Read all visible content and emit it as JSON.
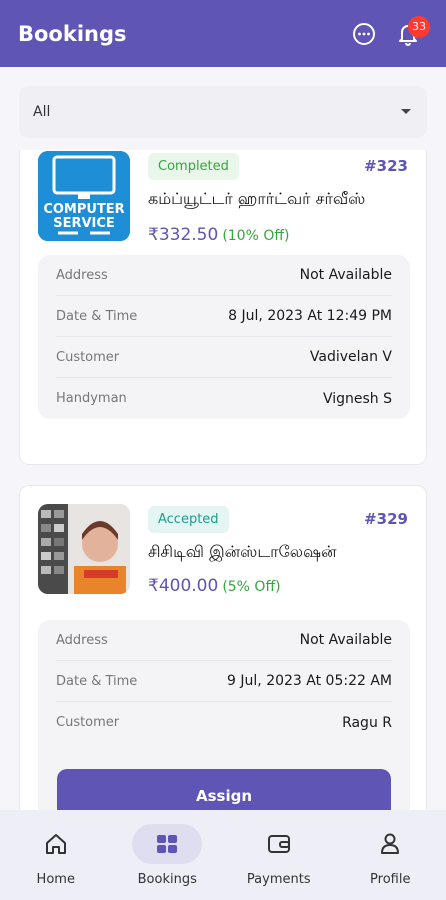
{
  "header": {
    "title": "Bookings",
    "notification_count": "33"
  },
  "filter": {
    "value": "All"
  },
  "bookings": [
    {
      "status": "Completed",
      "id": "#323",
      "service": "கம்ப்யூட்டர் ஹார்ட்வர் சர்வீஸ்",
      "price": "₹332.50",
      "discount": "(10% Off)",
      "thumb_text": [
        "COMPUTER",
        "SERVICE"
      ],
      "details": [
        {
          "label": "Address",
          "value": "Not Available"
        },
        {
          "label": "Date & Time",
          "value": "8 Jul, 2023 At 12:49 PM"
        },
        {
          "label": "Customer",
          "value": "Vadivelan V"
        },
        {
          "label": "Handyman",
          "value": "Vignesh S"
        }
      ]
    },
    {
      "status": "Accepted",
      "id": "#329",
      "service": "சிசிடிவி இன்ஸ்டாலேஷன்",
      "price": "₹400.00",
      "discount": "(5% Off)",
      "details": [
        {
          "label": "Address",
          "value": "Not Available"
        },
        {
          "label": "Date & Time",
          "value": "9 Jul, 2023 At 05:22 AM"
        },
        {
          "label": "Customer",
          "value": "Ragu R"
        }
      ],
      "action_label": "Assign"
    }
  ],
  "nav": [
    {
      "label": "Home",
      "icon": "home-icon"
    },
    {
      "label": "Bookings",
      "icon": "bookings-icon",
      "active": true
    },
    {
      "label": "Payments",
      "icon": "wallet-icon"
    },
    {
      "label": "Profile",
      "icon": "profile-icon"
    }
  ],
  "colors": {
    "primary": "#5e55b5",
    "completed": "#37a53f",
    "accepted": "#1e9c8d",
    "badge": "#ff3b30"
  }
}
